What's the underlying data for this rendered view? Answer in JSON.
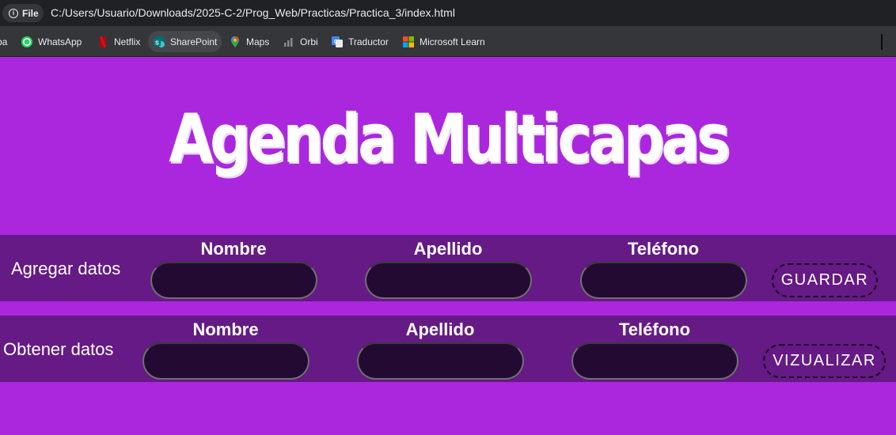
{
  "browser": {
    "file_chip_label": "File",
    "url": "C:/Users/Usuario/Downloads/2025-C-2/Prog_Web/Practicas/Practica_3/index.html",
    "bookmarks": [
      {
        "label": "ba",
        "icon": "partial-bookmark-icon"
      },
      {
        "label": "WhatsApp",
        "icon": "whatsapp-icon"
      },
      {
        "label": "Netflix",
        "icon": "netflix-icon"
      },
      {
        "label": "SharePoint",
        "icon": "sharepoint-icon"
      },
      {
        "label": "Maps",
        "icon": "maps-icon"
      },
      {
        "label": "Orbi",
        "icon": "orbi-icon"
      },
      {
        "label": "Traductor",
        "icon": "translate-icon"
      },
      {
        "label": "Microsoft Learn",
        "icon": "microsoft-icon"
      }
    ]
  },
  "page": {
    "title": "Agenda Multicapas",
    "add_section": {
      "label": "Agregar datos",
      "fields": [
        {
          "label": "Nombre",
          "value": ""
        },
        {
          "label": "Apellido",
          "value": ""
        },
        {
          "label": "Teléfono",
          "value": ""
        }
      ],
      "button_label": "GUARDAR"
    },
    "get_section": {
      "label": "Obtener datos",
      "fields": [
        {
          "label": "Nombre",
          "value": ""
        },
        {
          "label": "Apellido",
          "value": ""
        },
        {
          "label": "Teléfono",
          "value": ""
        }
      ],
      "button_label": "VIZUALIZAR"
    }
  },
  "colors": {
    "page_background": "#ab27de",
    "band_background": "#651a85",
    "input_background": "#230a32",
    "title_text": "#ffffff"
  }
}
